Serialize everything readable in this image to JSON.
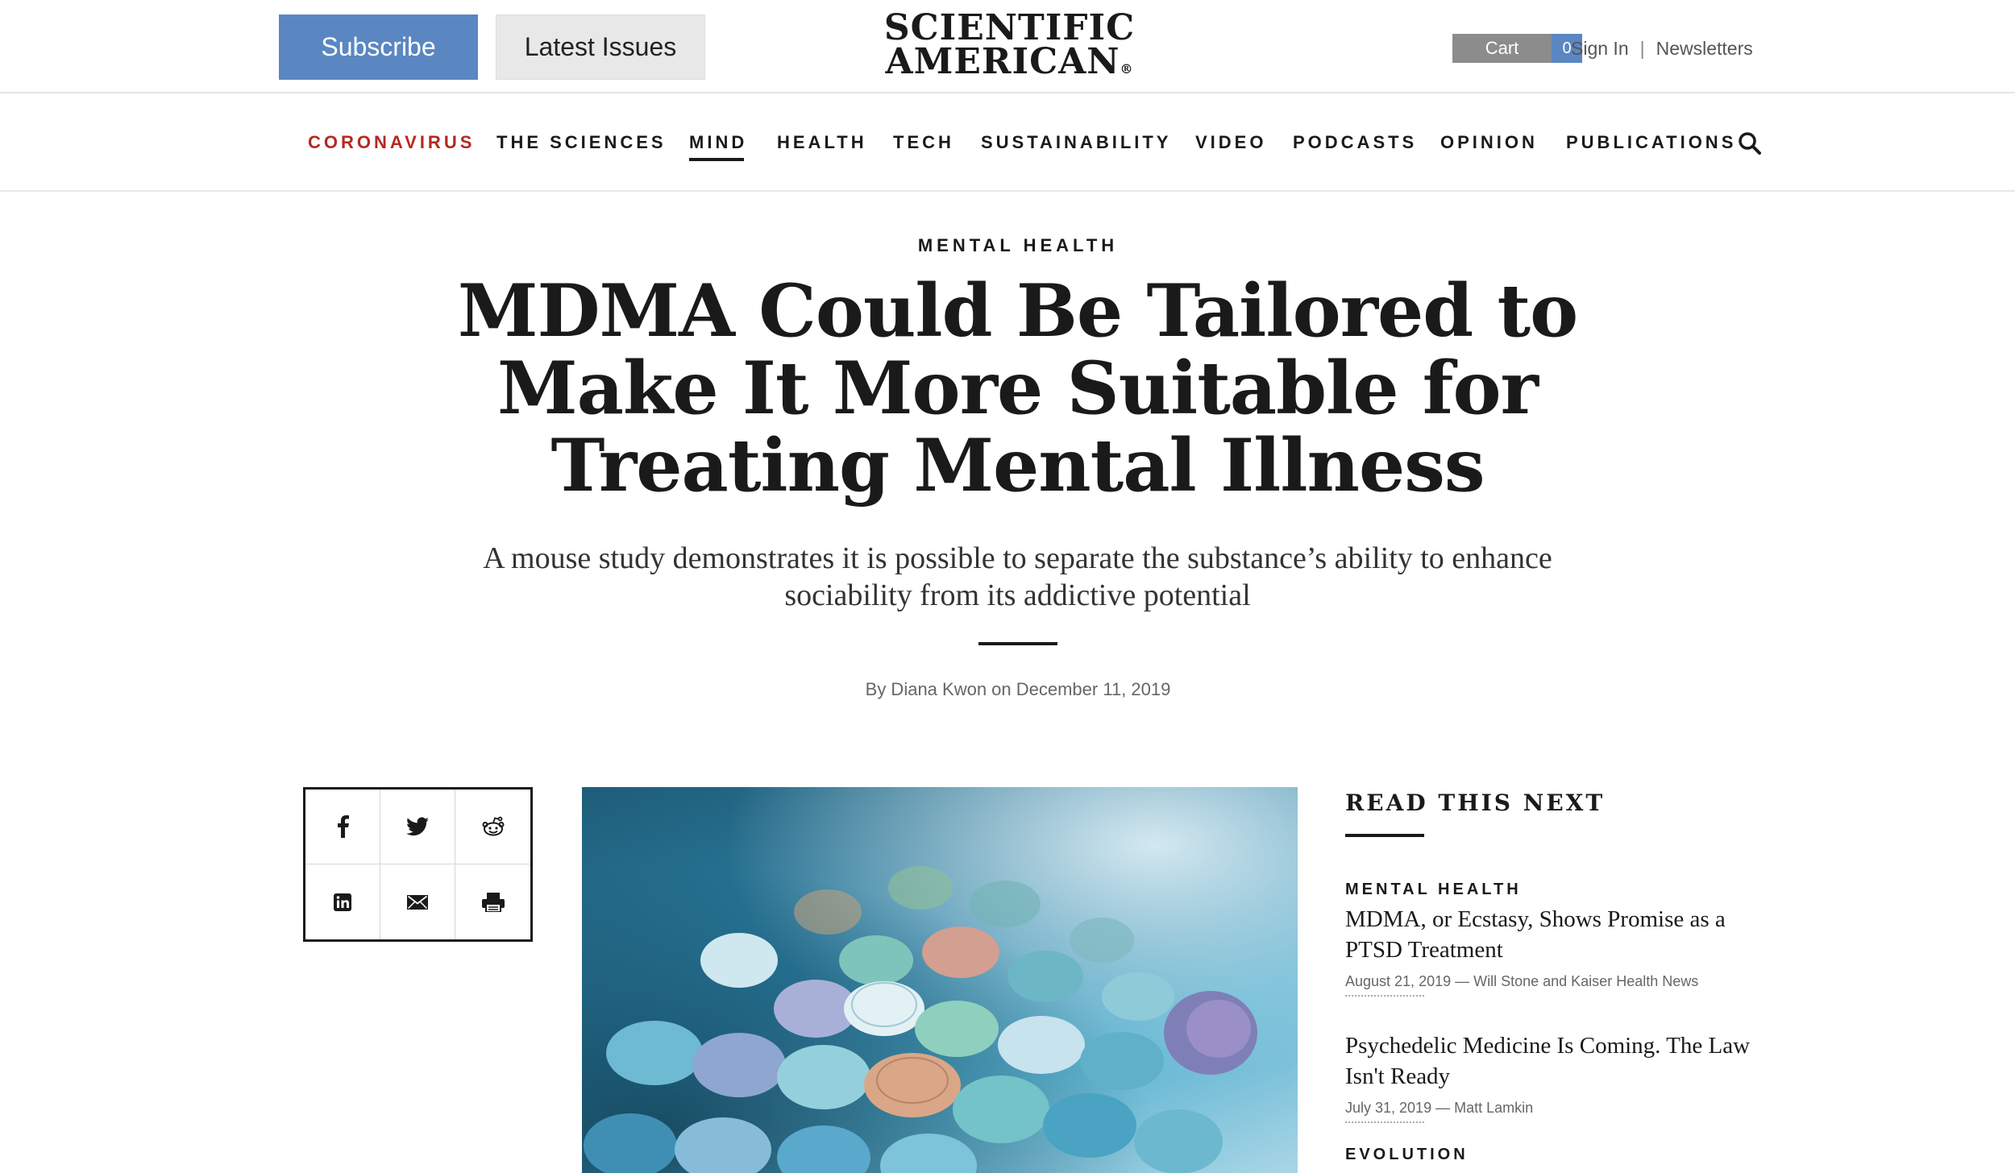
{
  "header": {
    "subscribe_label": "Subscribe",
    "latest_issues_label": "Latest Issues",
    "logo_line1": "SCIENTIFIC",
    "logo_line2": "AMERICAN",
    "logo_mark": "®",
    "cart_label": "Cart",
    "cart_count": "0",
    "sign_in_label": "Sign In",
    "separator": "|",
    "newsletters_label": "Newsletters"
  },
  "nav": {
    "items": [
      {
        "label": "CORONAVIRUS"
      },
      {
        "label": "THE SCIENCES"
      },
      {
        "label": "MIND"
      },
      {
        "label": "HEALTH"
      },
      {
        "label": "TECH"
      },
      {
        "label": "SUSTAINABILITY"
      },
      {
        "label": "VIDEO"
      },
      {
        "label": "PODCASTS"
      },
      {
        "label": "OPINION"
      },
      {
        "label": "PUBLICATIONS"
      }
    ],
    "active": "MIND",
    "highlight": "CORONAVIRUS",
    "highlight_color": "#b5281f",
    "search_icon": "search-icon"
  },
  "article": {
    "kicker": "MENTAL HEALTH",
    "headline": "MDMA Could Be Tailored to Make It More Suitable for Treating Mental Illness",
    "dek": "A mouse study demonstrates it is possible to separate the substance’s ability to enhance sociability from its addictive potential",
    "byline": "By Diana Kwon on December 11, 2019"
  },
  "share": {
    "icons": [
      "facebook-icon",
      "twitter-icon",
      "reddit-icon",
      "linkedin-icon",
      "email-icon",
      "print-icon"
    ]
  },
  "sidebar": {
    "title": "READ THIS NEXT",
    "items": [
      {
        "kicker": "MENTAL HEALTH",
        "headline": "MDMA, or Ecstasy, Shows Promise as a PTSD Treatment",
        "meta": "August 21, 2019 — Will Stone and Kaiser Health News"
      },
      {
        "kicker": "",
        "headline": "Psychedelic Medicine Is Coming. The Law Isn't Ready",
        "meta": "July 31, 2019 — Matt Lamkin"
      },
      {
        "kicker": "EVOLUTION",
        "headline": "",
        "meta": ""
      }
    ]
  },
  "colors": {
    "subscribe_bg": "#5a87c2",
    "cart_label_bg": "#8c8c8c",
    "cart_count_bg": "#5a87c2",
    "text": "#1a1a1a"
  }
}
